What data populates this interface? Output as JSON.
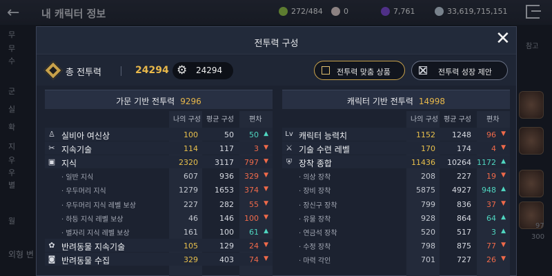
{
  "background": {
    "title": "내 캐릭터 정보",
    "resources": [
      {
        "icon": "gem-icon",
        "value": "272/484",
        "color": "#8fbf4a"
      },
      {
        "icon": "pearl-icon",
        "value": "0",
        "color": "#d8c8c8"
      },
      {
        "icon": "orb-icon",
        "value": "7,761",
        "color": "#7a4ad0"
      },
      {
        "icon": "coin-icon",
        "value": "33,619,715,151",
        "color": "#b8c8d8"
      }
    ],
    "left_labels": [
      "무",
      "무",
      "수",
      "군",
      "실",
      "확",
      "지",
      "우",
      "우",
      "별",
      "월"
    ],
    "left_bottom": "외형 변",
    "right_label": "참고",
    "right_numbers": [
      "97",
      "300"
    ]
  },
  "modal": {
    "title": "전투력 구성",
    "close_label": "✕"
  },
  "summary": {
    "label": "총 전투력",
    "value": "24294",
    "gear_value": "24294",
    "gift_button": "전투력 맞춤 상품",
    "report_button": "전투력 성장 제안"
  },
  "colors": {
    "accent_gold": "#e8b84a",
    "positive": "#4fd6c0",
    "negative": "#f06a4a"
  },
  "left_panel": {
    "title": "가문 기반 전투력",
    "value": "9296",
    "col_my": "나의 구성",
    "col_avg": "평균 구성",
    "col_dev": "편차",
    "rows": [
      {
        "type": "main",
        "icon": "goddess-icon",
        "name": "실비아 여신상",
        "my": "100",
        "avg": "50",
        "dev": "50",
        "dir": "up"
      },
      {
        "type": "main",
        "icon": "crossed-tools-icon",
        "name": "지속기술",
        "my": "114",
        "avg": "117",
        "dev": "3",
        "dir": "down"
      },
      {
        "type": "main",
        "icon": "book-icon",
        "name": "지식",
        "my": "2320",
        "avg": "3117",
        "dev": "797",
        "dir": "down"
      },
      {
        "type": "sub",
        "name": "· 일반 지식",
        "my": "607",
        "avg": "936",
        "dev": "329",
        "dir": "down"
      },
      {
        "type": "sub",
        "name": "· 우두머리 지식",
        "my": "1279",
        "avg": "1653",
        "dev": "374",
        "dir": "down"
      },
      {
        "type": "sub",
        "name": "· 우두머리 지식 레벨 보상",
        "my": "227",
        "avg": "282",
        "dev": "55",
        "dir": "down"
      },
      {
        "type": "sub",
        "name": "· 하등 지식 레벨 보상",
        "my": "46",
        "avg": "146",
        "dev": "100",
        "dir": "down"
      },
      {
        "type": "sub",
        "name": "· 별자리 지식 레벨 보상",
        "my": "161",
        "avg": "100",
        "dev": "61",
        "dir": "up"
      },
      {
        "type": "main",
        "icon": "paw-icon",
        "name": "반려동물 지속기술",
        "my": "105",
        "avg": "129",
        "dev": "24",
        "dir": "down"
      },
      {
        "type": "main",
        "icon": "pet-book-icon",
        "name": "반려동물 수집",
        "my": "329",
        "avg": "403",
        "dev": "74",
        "dir": "down"
      }
    ]
  },
  "right_panel": {
    "title": "캐릭터 기반 전투력",
    "value": "14998",
    "col_my": "나의 구성",
    "col_avg": "평균 구성",
    "col_dev": "편차",
    "rows": [
      {
        "type": "main",
        "icon": "level-icon",
        "icon_text": "Lv",
        "name": "캐릭터 능력치",
        "my": "1152",
        "avg": "1248",
        "dev": "96",
        "dir": "down"
      },
      {
        "type": "main",
        "icon": "crossed-swords-icon",
        "name": "기술 수련 레벨",
        "my": "170",
        "avg": "174",
        "dev": "4",
        "dir": "down"
      },
      {
        "type": "main",
        "icon": "armor-icon",
        "name": "장착 종합",
        "my": "11436",
        "avg": "10264",
        "dev": "1172",
        "dir": "up"
      },
      {
        "type": "sub",
        "name": "· 의상 장착",
        "my": "208",
        "avg": "227",
        "dev": "19",
        "dir": "down"
      },
      {
        "type": "sub",
        "name": "· 장비 장착",
        "my": "5875",
        "avg": "4927",
        "dev": "948",
        "dir": "up"
      },
      {
        "type": "sub",
        "name": "· 장신구 장착",
        "my": "799",
        "avg": "836",
        "dev": "37",
        "dir": "down"
      },
      {
        "type": "sub",
        "name": "· 유물 장착",
        "my": "928",
        "avg": "864",
        "dev": "64",
        "dir": "up"
      },
      {
        "type": "sub",
        "name": "· 연금석 장착",
        "my": "520",
        "avg": "517",
        "dev": "3",
        "dir": "up"
      },
      {
        "type": "sub",
        "name": "· 수정 장착",
        "my": "798",
        "avg": "875",
        "dev": "77",
        "dir": "down"
      },
      {
        "type": "sub",
        "name": "· 마력 각인",
        "my": "701",
        "avg": "727",
        "dev": "26",
        "dir": "down"
      }
    ]
  }
}
